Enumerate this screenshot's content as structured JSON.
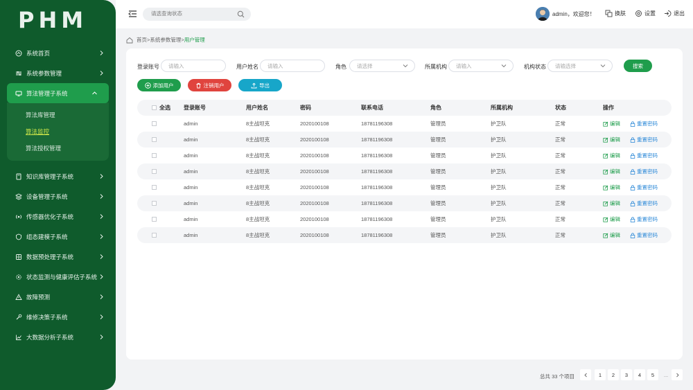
{
  "app": {
    "logo": "PHM"
  },
  "sidebar": {
    "items": [
      {
        "label": "系统首页",
        "icon": "home-icon"
      },
      {
        "label": "系统参数管理",
        "icon": "sliders-icon"
      },
      {
        "label": "算法管理子系统",
        "icon": "monitor-icon",
        "active": true
      },
      {
        "label": "知识库管理子系统",
        "icon": "book-icon"
      },
      {
        "label": "设备管理子系统",
        "icon": "layers-icon"
      },
      {
        "label": "传感器优化子系统",
        "icon": "sensor-icon"
      },
      {
        "label": "组态建模子系统",
        "icon": "shield-icon"
      },
      {
        "label": "数据预处理子系统",
        "icon": "grid-icon"
      },
      {
        "label": "状态监测与健康评估子系统",
        "icon": "settings-icon"
      },
      {
        "label": "故障预测",
        "icon": "warning-icon"
      },
      {
        "label": "维修决策子系统",
        "icon": "wrench-icon"
      },
      {
        "label": "大数据分析子系统",
        "icon": "chart-icon"
      }
    ],
    "subitems": [
      {
        "label": "算法库管理"
      },
      {
        "label": "算法监控",
        "current": true
      },
      {
        "label": "算法授权管理"
      }
    ]
  },
  "header": {
    "search_placeholder": "请选查询状态",
    "user_text": "admin，欢迎您！",
    "skin_label": "换肤",
    "settings_label": "设置",
    "logout_label": "退出"
  },
  "breadcrumb": {
    "home": "首页",
    "sep": ">",
    "level1": "系统参数管理",
    "current": "用户管理"
  },
  "filters": {
    "account_label": "登录账号",
    "account_placeholder": "请输入",
    "name_label": "用户姓名",
    "name_placeholder": "请输入",
    "role_label": "角色",
    "role_placeholder": "请选择",
    "org_label": "所属机构",
    "org_placeholder": "请输入",
    "status_label": "机构状态",
    "status_placeholder": "请输选择",
    "search_button": "搜索"
  },
  "actions": {
    "add_user": "添加用户",
    "delete_user": "注销用户",
    "export": "导出"
  },
  "table": {
    "headers": [
      "全选",
      "登录账号",
      "用户姓名",
      "密码",
      "联系电话",
      "角色",
      "所属机构",
      "状态",
      "操作"
    ],
    "rows": [
      [
        "admin",
        "8主战坦克",
        "2020100108",
        "18781196308",
        "管理员",
        "护卫队",
        "正常"
      ],
      [
        "admin",
        "8主战坦克",
        "2020100108",
        "18781196308",
        "管理员",
        "护卫队",
        "正常"
      ],
      [
        "admin",
        "8主战坦克",
        "2020100108",
        "18781196308",
        "管理员",
        "护卫队",
        "正常"
      ],
      [
        "admin",
        "8主战坦克",
        "2020100108",
        "18781196308",
        "管理员",
        "护卫队",
        "正常"
      ],
      [
        "admin",
        "8主战坦克",
        "2020100108",
        "18781196308",
        "管理员",
        "护卫队",
        "正常"
      ],
      [
        "admin",
        "8主战坦克",
        "2020100108",
        "18781196308",
        "管理员",
        "护卫队",
        "正常"
      ],
      [
        "admin",
        "8主战坦克",
        "2020100108",
        "18781196308",
        "管理员",
        "护卫队",
        "正常"
      ],
      [
        "admin",
        "8主战坦克",
        "2020100108",
        "18781196308",
        "管理员",
        "护卫队",
        "正常"
      ]
    ],
    "edit_label": "编辑",
    "reset_label": "重置密码"
  },
  "pagination": {
    "total": "总共 33 个项目",
    "pages": [
      "1",
      "2",
      "3",
      "4",
      "5"
    ],
    "ellipsis": "..."
  },
  "colors": {
    "sidebar": "#0f5b2c",
    "primary": "#1f9d4c",
    "danger": "#e0443e",
    "info": "#17a6c9",
    "link": "#2e8ad8"
  }
}
